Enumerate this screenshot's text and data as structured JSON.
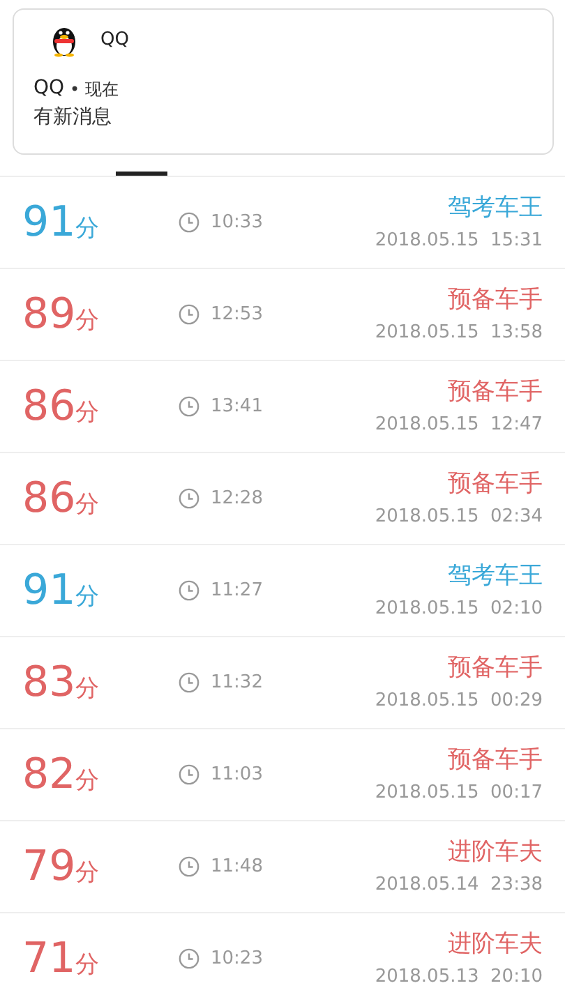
{
  "notification": {
    "app": "QQ",
    "sender": "QQ",
    "time": "• 现在",
    "message": "有新消息"
  },
  "records": [
    {
      "score": "91",
      "unit": "分",
      "color": "#3aa8d8",
      "duration": "10:33",
      "rank": "驾考车王",
      "date": "2018.05.15  15:31"
    },
    {
      "score": "89",
      "unit": "分",
      "color": "#e06464",
      "duration": "12:53",
      "rank": "预备车手",
      "date": "2018.05.15  13:58"
    },
    {
      "score": "86",
      "unit": "分",
      "color": "#e06464",
      "duration": "13:41",
      "rank": "预备车手",
      "date": "2018.05.15  12:47"
    },
    {
      "score": "86",
      "unit": "分",
      "color": "#e06464",
      "duration": "12:28",
      "rank": "预备车手",
      "date": "2018.05.15  02:34"
    },
    {
      "score": "91",
      "unit": "分",
      "color": "#3aa8d8",
      "duration": "11:27",
      "rank": "驾考车王",
      "date": "2018.05.15  02:10"
    },
    {
      "score": "83",
      "unit": "分",
      "color": "#e06464",
      "duration": "11:32",
      "rank": "预备车手",
      "date": "2018.05.15  00:29"
    },
    {
      "score": "82",
      "unit": "分",
      "color": "#e06464",
      "duration": "11:03",
      "rank": "预备车手",
      "date": "2018.05.15  00:17"
    },
    {
      "score": "79",
      "unit": "分",
      "color": "#e06464",
      "duration": "11:48",
      "rank": "进阶车夫",
      "date": "2018.05.14  23:38"
    },
    {
      "score": "71",
      "unit": "分",
      "color": "#e06464",
      "duration": "10:23",
      "rank": "进阶车夫",
      "date": "2018.05.13  20:10"
    }
  ]
}
